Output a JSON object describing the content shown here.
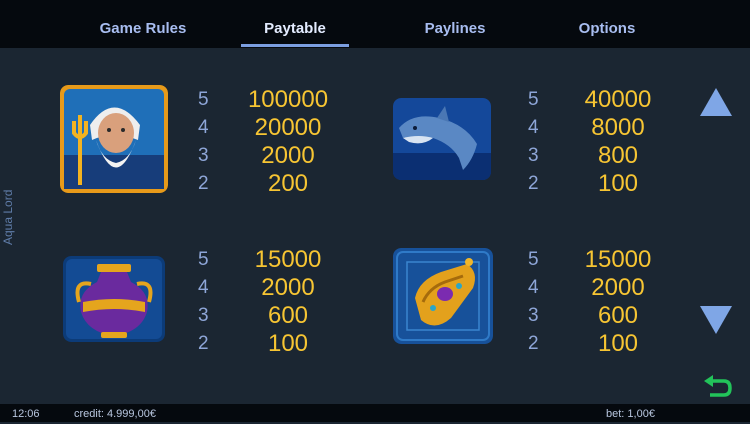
{
  "tabs": [
    {
      "label": "Game Rules",
      "active": false
    },
    {
      "label": "Paytable",
      "active": true
    },
    {
      "label": "Paylines",
      "active": false
    },
    {
      "label": "Options",
      "active": false
    }
  ],
  "side_title": "Aqua Lord",
  "paytable": [
    {
      "symbol": "poseidon-icon",
      "counts": [
        "5",
        "4",
        "3",
        "2"
      ],
      "payouts": [
        "100000",
        "20000",
        "2000",
        "200"
      ]
    },
    {
      "symbol": "dolphin-icon",
      "counts": [
        "5",
        "4",
        "3",
        "2"
      ],
      "payouts": [
        "40000",
        "8000",
        "800",
        "100"
      ]
    },
    {
      "symbol": "amphora-icon",
      "counts": [
        "5",
        "4",
        "3",
        "2"
      ],
      "payouts": [
        "15000",
        "2000",
        "600",
        "100"
      ]
    },
    {
      "symbol": "golden-bracelet-icon",
      "counts": [
        "5",
        "4",
        "3",
        "2"
      ],
      "payouts": [
        "15000",
        "2000",
        "600",
        "100"
      ]
    }
  ],
  "controls": {
    "scroll_up": "arrow-up-icon",
    "scroll_down": "arrow-down-icon",
    "back": "back-arrow-icon"
  },
  "status_bar": {
    "time": "12:06",
    "credit": "credit: 4.999,00€",
    "bet": "bet: 1,00€"
  },
  "colors": {
    "background": "#1b2632",
    "bar": "#05090e",
    "tab_text": "#a8bdf0",
    "payout": "#f7c533",
    "count": "#8ea6d8",
    "arrow": "#7fa6e6",
    "back_arrow": "#22c35a"
  }
}
